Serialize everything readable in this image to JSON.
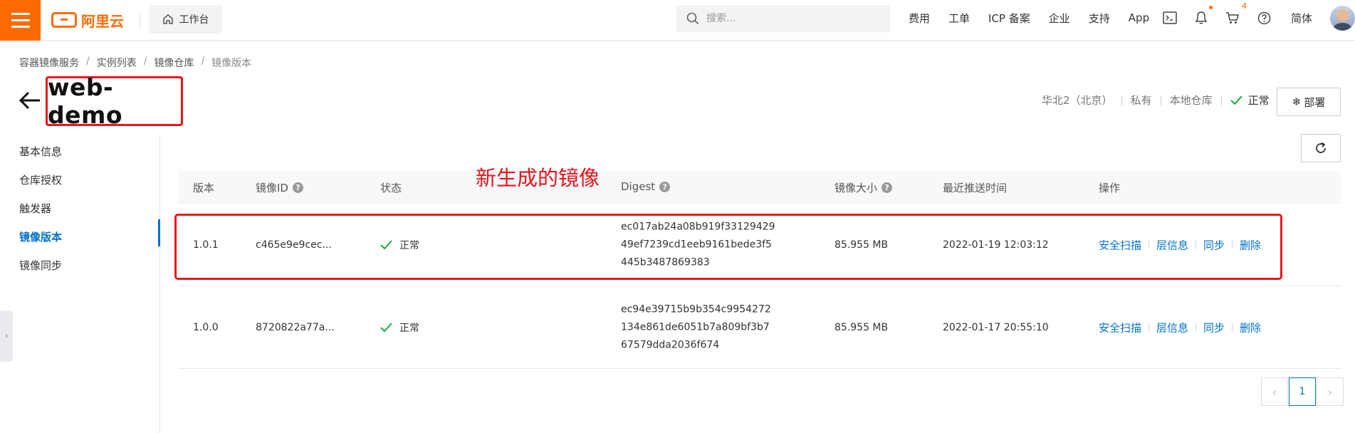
{
  "topbar": {
    "brand": "阿里云",
    "workbench": "工作台",
    "search_placeholder": "搜索...",
    "links": [
      "费用",
      "工单",
      "ICP 备案",
      "企业",
      "支持",
      "App"
    ],
    "cart_count": "4",
    "lang": "简体",
    "brand_color": "#ff6a00"
  },
  "breadcrumb": [
    "容器镜像服务",
    "实例列表",
    "镜像仓库",
    "镜像版本"
  ],
  "title": "web-demo",
  "meta": {
    "region": "华北2（北京）",
    "visibility": "私有",
    "source": "本地仓库",
    "status": "正常"
  },
  "deploy_label": "部署",
  "sidebar": {
    "items": [
      "基本信息",
      "仓库授权",
      "触发器",
      "镜像版本",
      "镜像同步"
    ],
    "active": "镜像版本"
  },
  "annotation": "新生成的镜像",
  "table": {
    "headers": {
      "version": "版本",
      "image_id": "镜像ID",
      "status": "状态",
      "digest": "Digest",
      "size": "镜像大小",
      "pushed": "最近推送时间",
      "ops": "操作"
    },
    "rows": [
      {
        "version": "1.0.1",
        "image_id": "c465e9e9cec...",
        "status": "正常",
        "digest_1": "ec017ab24a08b919f33129429",
        "digest_2": "49ef7239cd1eeb9161bede3f5",
        "digest_3": "445b3487869383",
        "size": "85.955 MB",
        "pushed": "2022-01-19 12:03:12",
        "op_scan": "安全扫描",
        "op_layers": "层信息",
        "op_sync": "同步",
        "op_delete": "删除"
      },
      {
        "version": "1.0.0",
        "image_id": "8720822a77a...",
        "status": "正常",
        "digest_1": "ec94e39715b9b354c9954272",
        "digest_2": "134e861de6051b7a809bf3b7",
        "digest_3": "67579dda2036f674",
        "size": "85.955 MB",
        "pushed": "2022-01-17 20:55:10",
        "op_scan": "安全扫描",
        "op_layers": "层信息",
        "op_sync": "同步",
        "op_delete": "删除"
      }
    ]
  },
  "pagination": {
    "current": "1"
  }
}
